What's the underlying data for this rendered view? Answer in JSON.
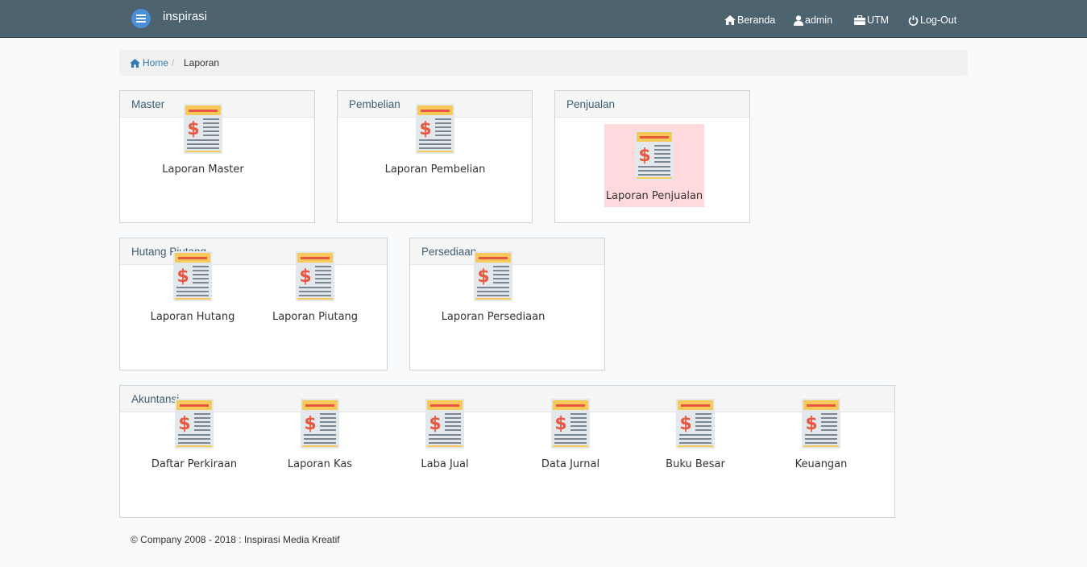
{
  "navbar": {
    "brand": "inspirasi",
    "links": {
      "beranda": "Beranda",
      "admin": "admin",
      "utm": "UTM",
      "logout": "Log-Out"
    }
  },
  "breadcrumb": {
    "home": "Home",
    "separator": "/",
    "current": "Laporan"
  },
  "panels": {
    "master": {
      "title": "Master",
      "items": [
        "Laporan Master"
      ]
    },
    "pembelian": {
      "title": "Pembelian",
      "items": [
        "Laporan Pembelian"
      ]
    },
    "penjualan": {
      "title": "Penjualan",
      "items": [
        "Laporan Penjualan"
      ]
    },
    "hutang_piutang": {
      "title": "Hutang Piutang",
      "items": [
        "Laporan Hutang",
        "Laporan Piutang"
      ]
    },
    "persediaan": {
      "title": "Persediaan",
      "items": [
        "Laporan Persediaan"
      ]
    },
    "akuntansi": {
      "title": "Akuntansi",
      "items": [
        "Daftar Perkiraan",
        "Laporan Kas",
        "Laba Jual",
        "Data Jurnal",
        "Buku Besar",
        "Keuangan"
      ]
    }
  },
  "footer": "© Company 2008 - 2018 : Inspirasi Media Kreatif",
  "colors": {
    "navbar": "#4d6370",
    "link": "#337ab7",
    "highlight": "#ffd9db",
    "panel_title": "#3d5e72"
  }
}
